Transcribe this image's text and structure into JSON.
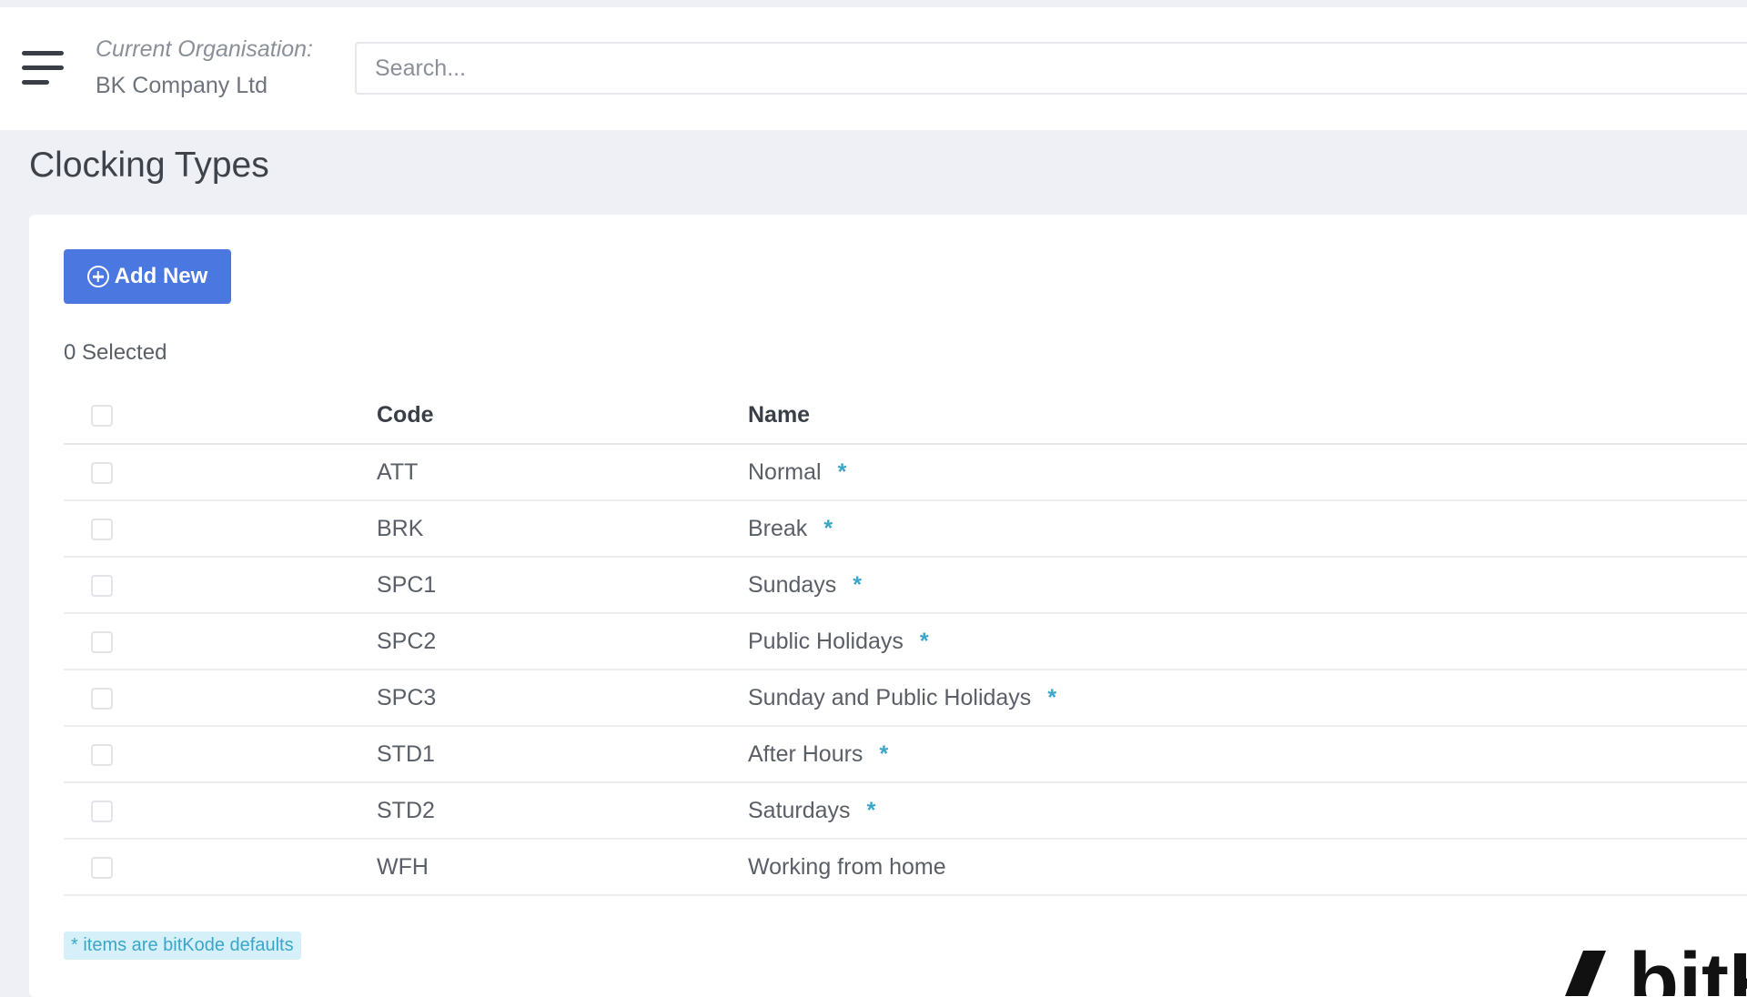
{
  "header": {
    "org_label": "Current Organisation:",
    "org_name": "BK Company Ltd",
    "search_placeholder": "Search..."
  },
  "page": {
    "title": "Clocking Types"
  },
  "toolbar": {
    "add_new_label": "Add New",
    "selected_text": "0 Selected"
  },
  "table": {
    "columns": [
      "Code",
      "Name"
    ],
    "rows": [
      {
        "code": "ATT",
        "name": "Normal",
        "star": "*"
      },
      {
        "code": "BRK",
        "name": "Break",
        "star": "*"
      },
      {
        "code": "SPC1",
        "name": "Sundays",
        "star": "*"
      },
      {
        "code": "SPC2",
        "name": "Public Holidays",
        "star": "*"
      },
      {
        "code": "SPC3",
        "name": "Sunday and Public Holidays",
        "star": "*"
      },
      {
        "code": "STD1",
        "name": "After Hours",
        "star": "*"
      },
      {
        "code": "STD2",
        "name": "Saturdays",
        "star": "*"
      },
      {
        "code": "WFH",
        "name": "Working from home",
        "star": ""
      }
    ]
  },
  "footer": {
    "defaults_note": "* items are bitKode defaults"
  },
  "colors": {
    "accent": "#4a77e0",
    "star": "#3aa6c7"
  }
}
